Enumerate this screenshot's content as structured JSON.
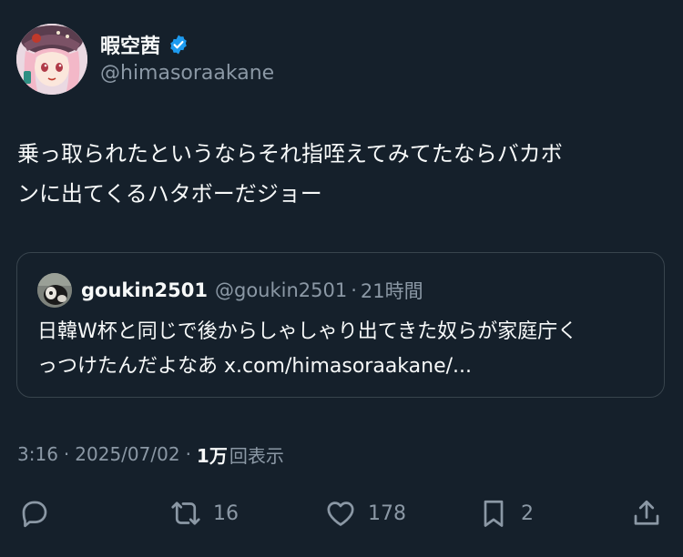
{
  "author": {
    "display_name": "暇空茜",
    "handle": "@himasoraakane",
    "verified": true,
    "verified_color": "#1d9bf0"
  },
  "tweet": {
    "text_lines": [
      "乗っ取られたというならそれ指咥えてみてたならバカボ",
      "ンに出てくるハタボーだジョー"
    ]
  },
  "quote": {
    "display_name": "goukin2501",
    "handle": "@goukin2501",
    "separator": "·",
    "time": "21時間",
    "text_lines": [
      "日韓W杯と同じで後からしゃしゃり出てきた奴らが家庭庁く",
      "っつけたんだよなあ x.com/himasoraakane/..."
    ]
  },
  "meta": {
    "time": "3:16",
    "separator": "·",
    "date": "2025/07/02",
    "views_count": "1万",
    "views_label": "回表示"
  },
  "actions": {
    "reply": {
      "icon": "reply-icon",
      "count": ""
    },
    "retweet": {
      "icon": "retweet-icon",
      "count": "16"
    },
    "like": {
      "icon": "heart-icon",
      "count": "178"
    },
    "bookmark": {
      "icon": "bookmark-icon",
      "count": "2"
    },
    "share": {
      "icon": "share-icon",
      "count": ""
    }
  },
  "colors": {
    "background": "#15202b",
    "text_primary": "#f7f9f9",
    "text_secondary": "#8b98a5",
    "border": "#38444d",
    "accent": "#1d9bf0"
  }
}
